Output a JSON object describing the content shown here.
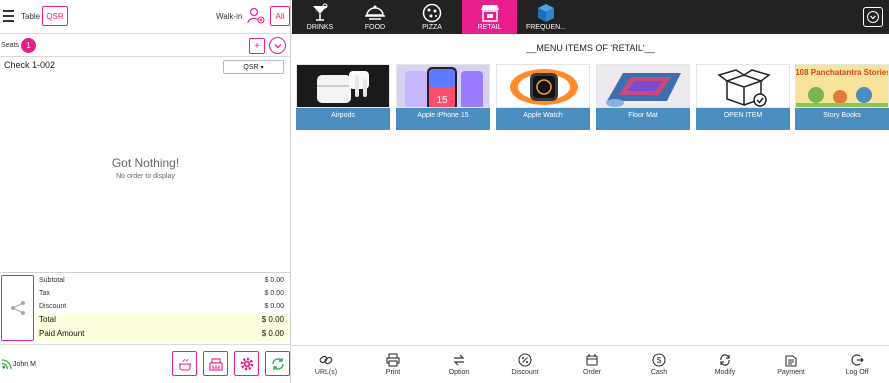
{
  "order_panel": {
    "table_label": "Table",
    "table_mode": "QSR",
    "walkin_label": "Walk-in",
    "all_label": "All",
    "seats_label": "Seats",
    "seat_count": "1",
    "plus_label": "+",
    "check_title": "Check 1-002",
    "order_type": "QSR",
    "empty_title": "Got Nothing!",
    "empty_subtitle": "No order to display",
    "totals": [
      {
        "label": "Subtotal",
        "value": "$ 0.00"
      },
      {
        "label": "Tax",
        "value": "$ 0.00"
      },
      {
        "label": "Discount",
        "value": "$ 0.00"
      },
      {
        "label": "Total",
        "value": "$ 0.00"
      },
      {
        "label": "Paid Amount",
        "value": "$ 0.00"
      }
    ],
    "user_name": "John M"
  },
  "categories": [
    {
      "label": "DRINKS",
      "icon": "cocktail-icon"
    },
    {
      "label": "FOOD",
      "icon": "cloche-icon"
    },
    {
      "label": "PIZZA",
      "icon": "pizza-icon"
    },
    {
      "label": "RETAIL",
      "icon": "shop-icon"
    },
    {
      "label": "FREQUEN...",
      "icon": "cube-icon"
    }
  ],
  "menu_title": "__MENU ITEMS OF 'RETAIL'__",
  "menu_items": [
    {
      "label": "Airpods"
    },
    {
      "label": "Apple iPhone 15"
    },
    {
      "label": "Apple Watch"
    },
    {
      "label": "Floor Mat"
    },
    {
      "label": "OPEN ITEM"
    },
    {
      "label": "Story Books"
    }
  ],
  "phone_screen_text": "15",
  "book_cover_text": "108 Panchatantra Stories",
  "actions": [
    {
      "label": "URL(s)",
      "icon": "link-icon"
    },
    {
      "label": "Print",
      "icon": "printer-icon"
    },
    {
      "label": "Option",
      "icon": "swap-icon"
    },
    {
      "label": "Discount",
      "icon": "percent-icon"
    },
    {
      "label": "Order",
      "icon": "order-icon"
    },
    {
      "label": "Cash",
      "icon": "cash-icon"
    },
    {
      "label": "Modify",
      "icon": "refresh-icon"
    },
    {
      "label": "Payment",
      "icon": "payment-icon"
    },
    {
      "label": "Log Off",
      "icon": "logoff-icon"
    }
  ],
  "colors": {
    "accent": "#e91e8c",
    "tile_caption": "#4a8dbf",
    "category_bar": "#222222"
  }
}
